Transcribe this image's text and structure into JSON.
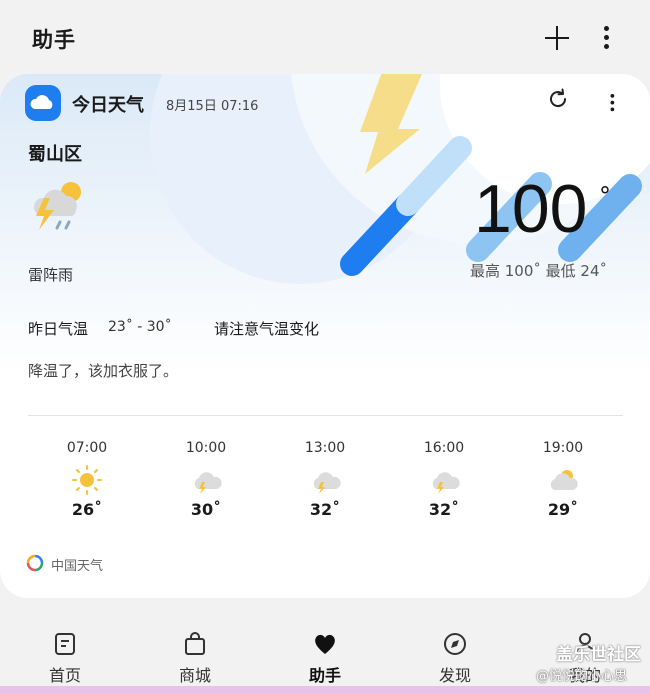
{
  "header": {
    "title": "助手",
    "add_icon": "plus-icon",
    "more_icon": "more-vert-icon"
  },
  "card": {
    "app_name": "今日天气",
    "updated": "8月15日 07:16",
    "district": "蜀山区",
    "temperature": "100",
    "degree_symbol": "°",
    "high_low": "最高 100˚  最低 24˚",
    "condition": "雷阵雨",
    "yesterday_label": "昨日气温",
    "yesterday_range": "23˚ - 30˚",
    "advice": "请注意气温变化",
    "tip": "降温了，该加衣服了。",
    "hourly": [
      {
        "time": "07:00",
        "temp": "26˚",
        "icon": "sunny-icon"
      },
      {
        "time": "10:00",
        "temp": "30˚",
        "icon": "thunderstorm-icon"
      },
      {
        "time": "13:00",
        "temp": "32˚",
        "icon": "thunderstorm-icon"
      },
      {
        "time": "16:00",
        "temp": "32˚",
        "icon": "thunderstorm-icon"
      },
      {
        "time": "19:00",
        "temp": "29˚",
        "icon": "partly-cloudy-icon"
      }
    ],
    "source": "中国天气",
    "accent_color": "#1e7ef0"
  },
  "nav": {
    "items": [
      {
        "label": "首页",
        "icon": "home-icon"
      },
      {
        "label": "商城",
        "icon": "shopping-bag-icon"
      },
      {
        "label": "助手",
        "icon": "heart-icon"
      },
      {
        "label": "发现",
        "icon": "compass-icon"
      },
      {
        "label": "我的",
        "icon": "person-icon"
      }
    ]
  },
  "watermark": {
    "line1": "盖乐世社区",
    "line2": "@悦悦的小心思"
  }
}
